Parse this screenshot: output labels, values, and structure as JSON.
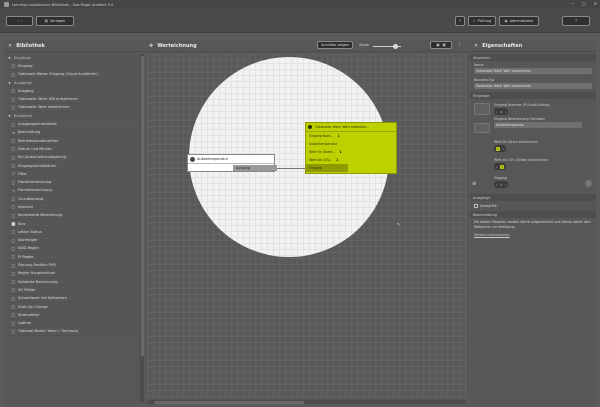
{
  "window": {
    "title": "Lernmag Logikbuchen Bibliothek - Das Magic Ambient 5.0",
    "minimize": "─",
    "maximize": "□",
    "close": "✕"
  },
  "toolbar": {
    "back_label": "‹",
    "forward_label": "›",
    "template_label": "Vorlagen",
    "help_label": "?",
    "preview_label": "Prüfung",
    "admin_label": "Administrator",
    "more_label": "?"
  },
  "library": {
    "title": "Bibliothek",
    "items": [
      {
        "kind": "cat",
        "label": "Eingänge"
      },
      {
        "kind": "sub",
        "icon": "▢",
        "label": "Eingang"
      },
      {
        "kind": "sub",
        "icon": "▢",
        "label": "Optionale Werte: Eingang (Cloud Ausführen)"
      },
      {
        "kind": "cat",
        "label": "Ausgänge"
      },
      {
        "kind": "sub",
        "icon": "▢",
        "label": "Ausgang"
      },
      {
        "kind": "sub",
        "icon": "▢",
        "label": "Optionaler Wert: VIN aufzeichnen"
      },
      {
        "kind": "sub",
        "icon": "▢",
        "label": "Optionaler Wert aufzeichnen"
      },
      {
        "kind": "cat",
        "label": "Bausteine"
      },
      {
        "kind": "sub",
        "icon": "▢",
        "label": "Ausgangsschwellwert"
      },
      {
        "kind": "sub",
        "icon": "≡",
        "label": "Beschaltung"
      },
      {
        "kind": "sub",
        "icon": "▢",
        "label": "Betriebsstundenzähler"
      },
      {
        "kind": "sub",
        "icon": "▢",
        "label": "Datum und Minute"
      },
      {
        "kind": "sub",
        "icon": "▢",
        "label": "Ein-/Ausschaltverzögerung"
      },
      {
        "kind": "sub",
        "icon": "▢",
        "label": "Eingangsschaltzähler"
      },
      {
        "kind": "sub",
        "icon": "▽",
        "label": "Filter"
      },
      {
        "kind": "sub",
        "icon": "▢",
        "label": "Flankenerkennung"
      },
      {
        "kind": "sub",
        "icon": "∿",
        "label": "Formelberechnung"
      },
      {
        "kind": "sub",
        "icon": "▢",
        "label": "Grundkonzept"
      },
      {
        "kind": "sub",
        "icon": "▢",
        "label": "Intervall"
      },
      {
        "kind": "sub",
        "icon": "▢",
        "label": "Jahreswerte Berechnung"
      },
      {
        "kind": "sub",
        "icon": "⬤",
        "label": "Kiez"
      },
      {
        "kind": "sub",
        "icon": "▢",
        "label": "Letzer Status"
      },
      {
        "kind": "sub",
        "icon": "▢",
        "label": "Nachfolger"
      },
      {
        "kind": "sub",
        "icon": "▢",
        "label": "NOD-Regler"
      },
      {
        "kind": "sub",
        "icon": "▢",
        "label": "PI Regler"
      },
      {
        "kind": "sub",
        "icon": "▢",
        "label": "Planung Position PVR"
      },
      {
        "kind": "sub",
        "icon": "▢",
        "label": "Regler Haupterhitzer"
      },
      {
        "kind": "sub",
        "icon": "▢",
        "label": "Sollwerte Berechnung"
      },
      {
        "kind": "sub",
        "icon": "▢",
        "label": "SG Pfeiler"
      },
      {
        "kind": "sub",
        "icon": "▢",
        "label": "Schwellwert mit Sollwerten"
      },
      {
        "kind": "sub",
        "icon": "▢",
        "label": "Start Up Change"
      },
      {
        "kind": "sub",
        "icon": "▢",
        "label": "Stromzähler"
      },
      {
        "kind": "sub",
        "icon": "▢",
        "label": "Uptime"
      },
      {
        "kind": "sub",
        "icon": "▢",
        "label": "Optional Modul: Wann / Trennung"
      }
    ]
  },
  "canvas": {
    "title": "Werteichnung",
    "toggle_label": "Scrollbar zeigen",
    "zoom_label": "Zoom",
    "source_node": {
      "title": "Außentemperatur",
      "port": "Ausgang"
    },
    "selected_node": {
      "title": "Optionaler Wert: Wert aufzeichn...",
      "rows": [
        {
          "label": "Eingang Nom...",
          "value": "1"
        },
        {
          "label": "Außentemperatur",
          "value": ""
        },
        {
          "label": "Wert für Überk...",
          "value": "1"
        },
        {
          "label": "Wert als CSV...",
          "value": "1"
        },
        {
          "label": "Eingang",
          "value": ""
        }
      ]
    }
  },
  "properties": {
    "title": "Eigenschaften",
    "section_general": "Allgemein",
    "name_label": "Name",
    "name_value": "Optionaler Wert: Wert aufzeichnen",
    "type_label": "Baustein-Typ",
    "type_value": "Optionaler Wert: Wert aufzeichnen",
    "section_inputs": "Eingänge",
    "input1_label": "Eingang Nummer (Pi-Limit-Eintrag)",
    "input1_value": "1",
    "input2_label": "Eingang Bezeichnung (Variabel)",
    "input2_value": "Außentemperatur",
    "input3_label": "Wert für Überk aufzeichnen",
    "input3_value": "1",
    "input4_label": "Wert als CSV (Onlbe) aufzeichnen",
    "input4_value": "1",
    "input5_label": "Eingang",
    "input5_value": "1",
    "section_outputs": "Ausgänge",
    "output_check_label": "Unbegriffe",
    "section_notes": "Beschreibung",
    "hint_text": "Mit diesem Baustein werden Werte aufgezeichnet und stehen damit dem Webserver zur Verfügung.",
    "more_link": "Weitere Informationen"
  },
  "colors": {
    "accent": "#bfd000",
    "background": "#5b5b5b"
  }
}
